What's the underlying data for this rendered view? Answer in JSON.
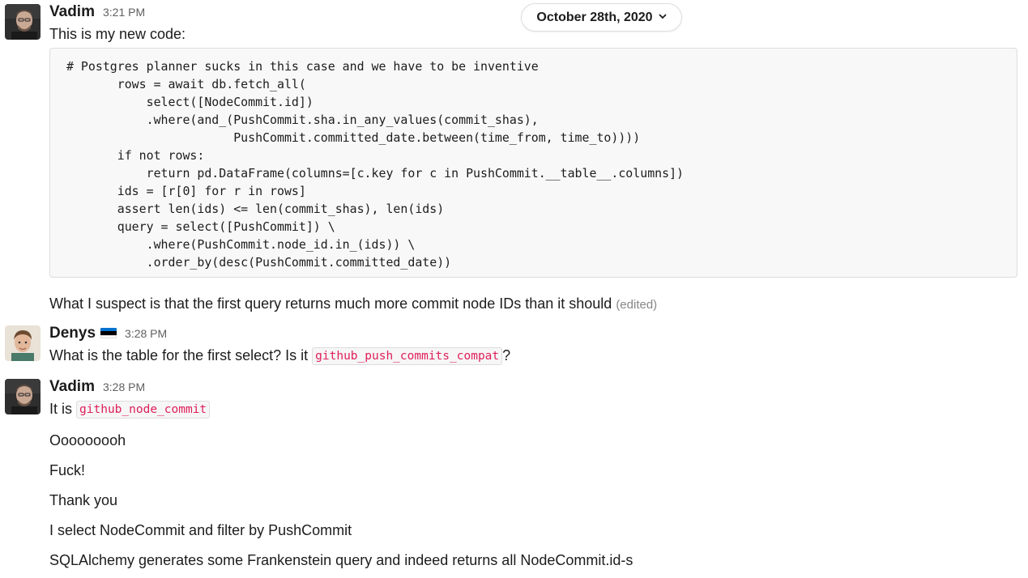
{
  "date_divider": {
    "label": "October 28th, 2020",
    "icon": "chevron-down-icon"
  },
  "messages": [
    {
      "author": "Vadim",
      "time": "3:21 PM",
      "intro": "This is my new code:",
      "code_lines": [
        "# Postgres planner sucks in this case and we have to be inventive",
        "       rows = await db.fetch_all(",
        "           select([NodeCommit.id])",
        "           .where(and_(PushCommit.sha.in_any_values(commit_shas),",
        "                       PushCommit.committed_date.between(time_from, time_to))))",
        "       if not rows:",
        "           return pd.DataFrame(columns=[c.key for c in PushCommit.__table__.columns])",
        "       ids = [r[0] for r in rows]",
        "       assert len(ids) <= len(commit_shas), len(ids)",
        "       query = select([PushCommit]) \\",
        "           .where(PushCommit.node_id.in_(ids)) \\",
        "           .order_by(desc(PushCommit.committed_date))"
      ],
      "followup": "What I suspect is that the first query returns much more commit node IDs than it should",
      "edited": "(edited)"
    },
    {
      "author": "Denys",
      "status_emoji": "estonia-flag-icon",
      "time": "3:28 PM",
      "text_before": "What is the table for the first select? Is it",
      "code": "github_push_commits_compat",
      "text_after": "?"
    },
    {
      "author": "Vadim",
      "time": "3:28 PM",
      "text_before": "It is",
      "code": "github_node_commit",
      "lines": [
        "Ooooooooh",
        "Fuck!",
        "Thank you",
        "I select NodeCommit and filter by PushCommit",
        "SQLAlchemy generates some Frankenstein query and indeed returns all NodeCommit.id-s"
      ]
    }
  ],
  "colors": {
    "inline_code": "#e01e5a",
    "timestamp": "#616061",
    "code_bg": "#f8f8f8",
    "flag": [
      "#0072CE",
      "#000000",
      "#FFFFFF"
    ]
  }
}
